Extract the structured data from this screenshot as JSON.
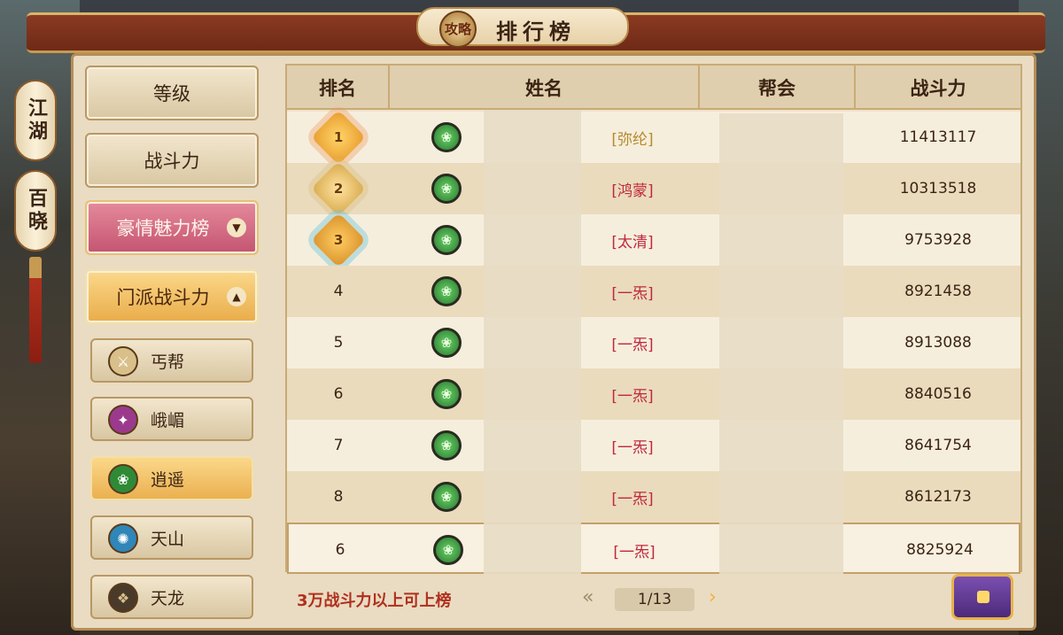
{
  "header": {
    "title": "排行榜",
    "guide_badge": "攻略"
  },
  "side_tabs": [
    {
      "label": "江湖"
    },
    {
      "label": "百晓"
    }
  ],
  "categories": [
    {
      "label": "等级",
      "style": "normal"
    },
    {
      "label": "战斗力",
      "style": "normal"
    },
    {
      "label": "豪情魅力榜",
      "style": "pink",
      "chevron": "chevron-down-icon"
    },
    {
      "label": "门派战斗力",
      "style": "gold",
      "chevron": "chevron-up-icon"
    }
  ],
  "sects": [
    {
      "label": "丐帮",
      "icon": "sword-icon",
      "color": "#6b4a1a",
      "active": false
    },
    {
      "label": "峨嵋",
      "icon": "blade-icon",
      "color": "#9b3a8c",
      "active": false
    },
    {
      "label": "逍遥",
      "icon": "leaf-icon",
      "color": "#2f8a36",
      "active": true
    },
    {
      "label": "天山",
      "icon": "ring-icon",
      "color": "#2f86b8",
      "active": false
    },
    {
      "label": "天龙",
      "icon": "dragon-icon",
      "color": "#d9c08a",
      "active": false
    }
  ],
  "table": {
    "headers": {
      "rank": "排名",
      "name": "姓名",
      "guild": "帮会",
      "power": "战斗力"
    },
    "rows": [
      {
        "rank": "1",
        "guild_tag": "[弥纶]",
        "guild_color": "#b58a2a",
        "power": "11413117"
      },
      {
        "rank": "2",
        "guild_tag": "[鸿蒙]",
        "guild_color": "#c0283c",
        "power": "10313518"
      },
      {
        "rank": "3",
        "guild_tag": "[太清]",
        "guild_color": "#c0283c",
        "power": "9753928"
      },
      {
        "rank": "4",
        "guild_tag": "[一炁]",
        "guild_color": "#c0283c",
        "power": "8921458"
      },
      {
        "rank": "5",
        "guild_tag": "[一炁]",
        "guild_color": "#c0283c",
        "power": "8913088"
      },
      {
        "rank": "6",
        "guild_tag": "[一炁]",
        "guild_color": "#c0283c",
        "power": "8840516"
      },
      {
        "rank": "7",
        "guild_tag": "[一炁]",
        "guild_color": "#c0283c",
        "power": "8641754"
      },
      {
        "rank": "8",
        "guild_tag": "[一炁]",
        "guild_color": "#c0283c",
        "power": "8612173"
      }
    ],
    "my_row": {
      "rank": "6",
      "guild_tag": "[一炁]",
      "guild_color": "#c0283c",
      "power": "8825924"
    }
  },
  "footer": {
    "requirement": "3万战斗力以上可上榜",
    "page": "1/13",
    "prev_icon": "double-chevron-left-icon",
    "next_icon": "chevron-right-icon",
    "reward_icon": "treasure-chest-icon"
  }
}
